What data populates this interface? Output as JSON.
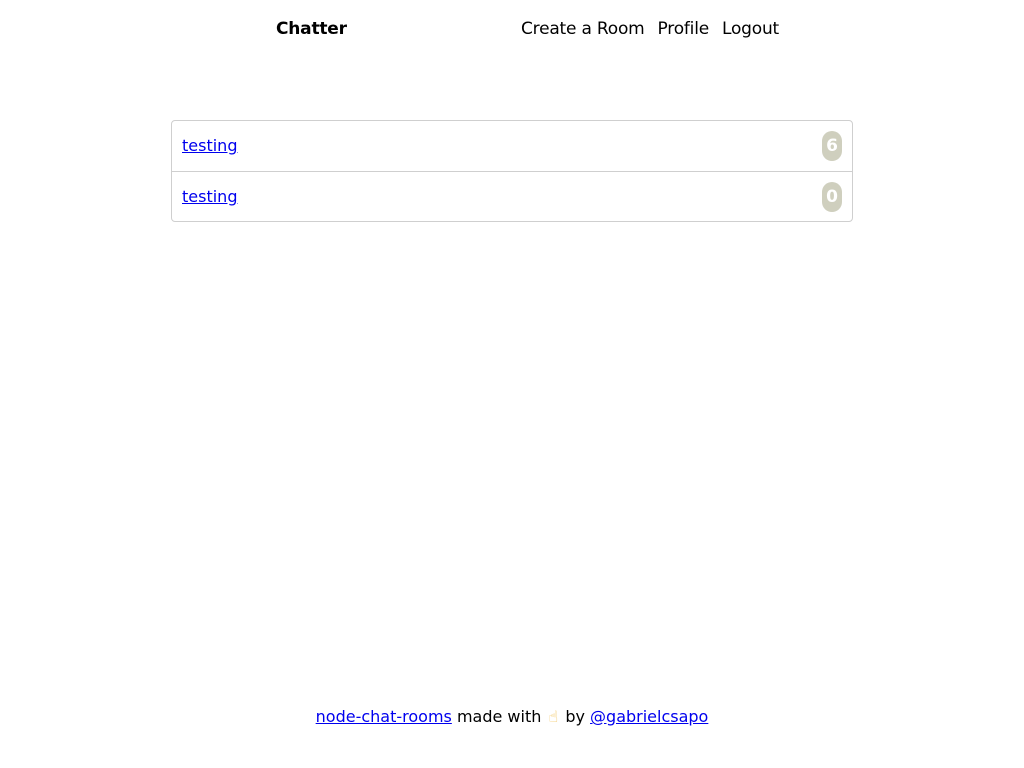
{
  "navbar": {
    "brand": "Chatter",
    "links": [
      "Create a Room",
      "Profile",
      "Logout"
    ]
  },
  "rooms": [
    {
      "name": "testing",
      "count": "6"
    },
    {
      "name": "testing",
      "count": "0"
    }
  ],
  "footer": {
    "project_link": "node-chat-rooms",
    "made_with": "made with",
    "icon": "pointing-hand-icon",
    "by": "by",
    "author_link": "@gabrielcsapo"
  },
  "colors": {
    "link": "#0000ee",
    "badge_bg": "#cfcfbe",
    "border": "#cfcfcf"
  }
}
